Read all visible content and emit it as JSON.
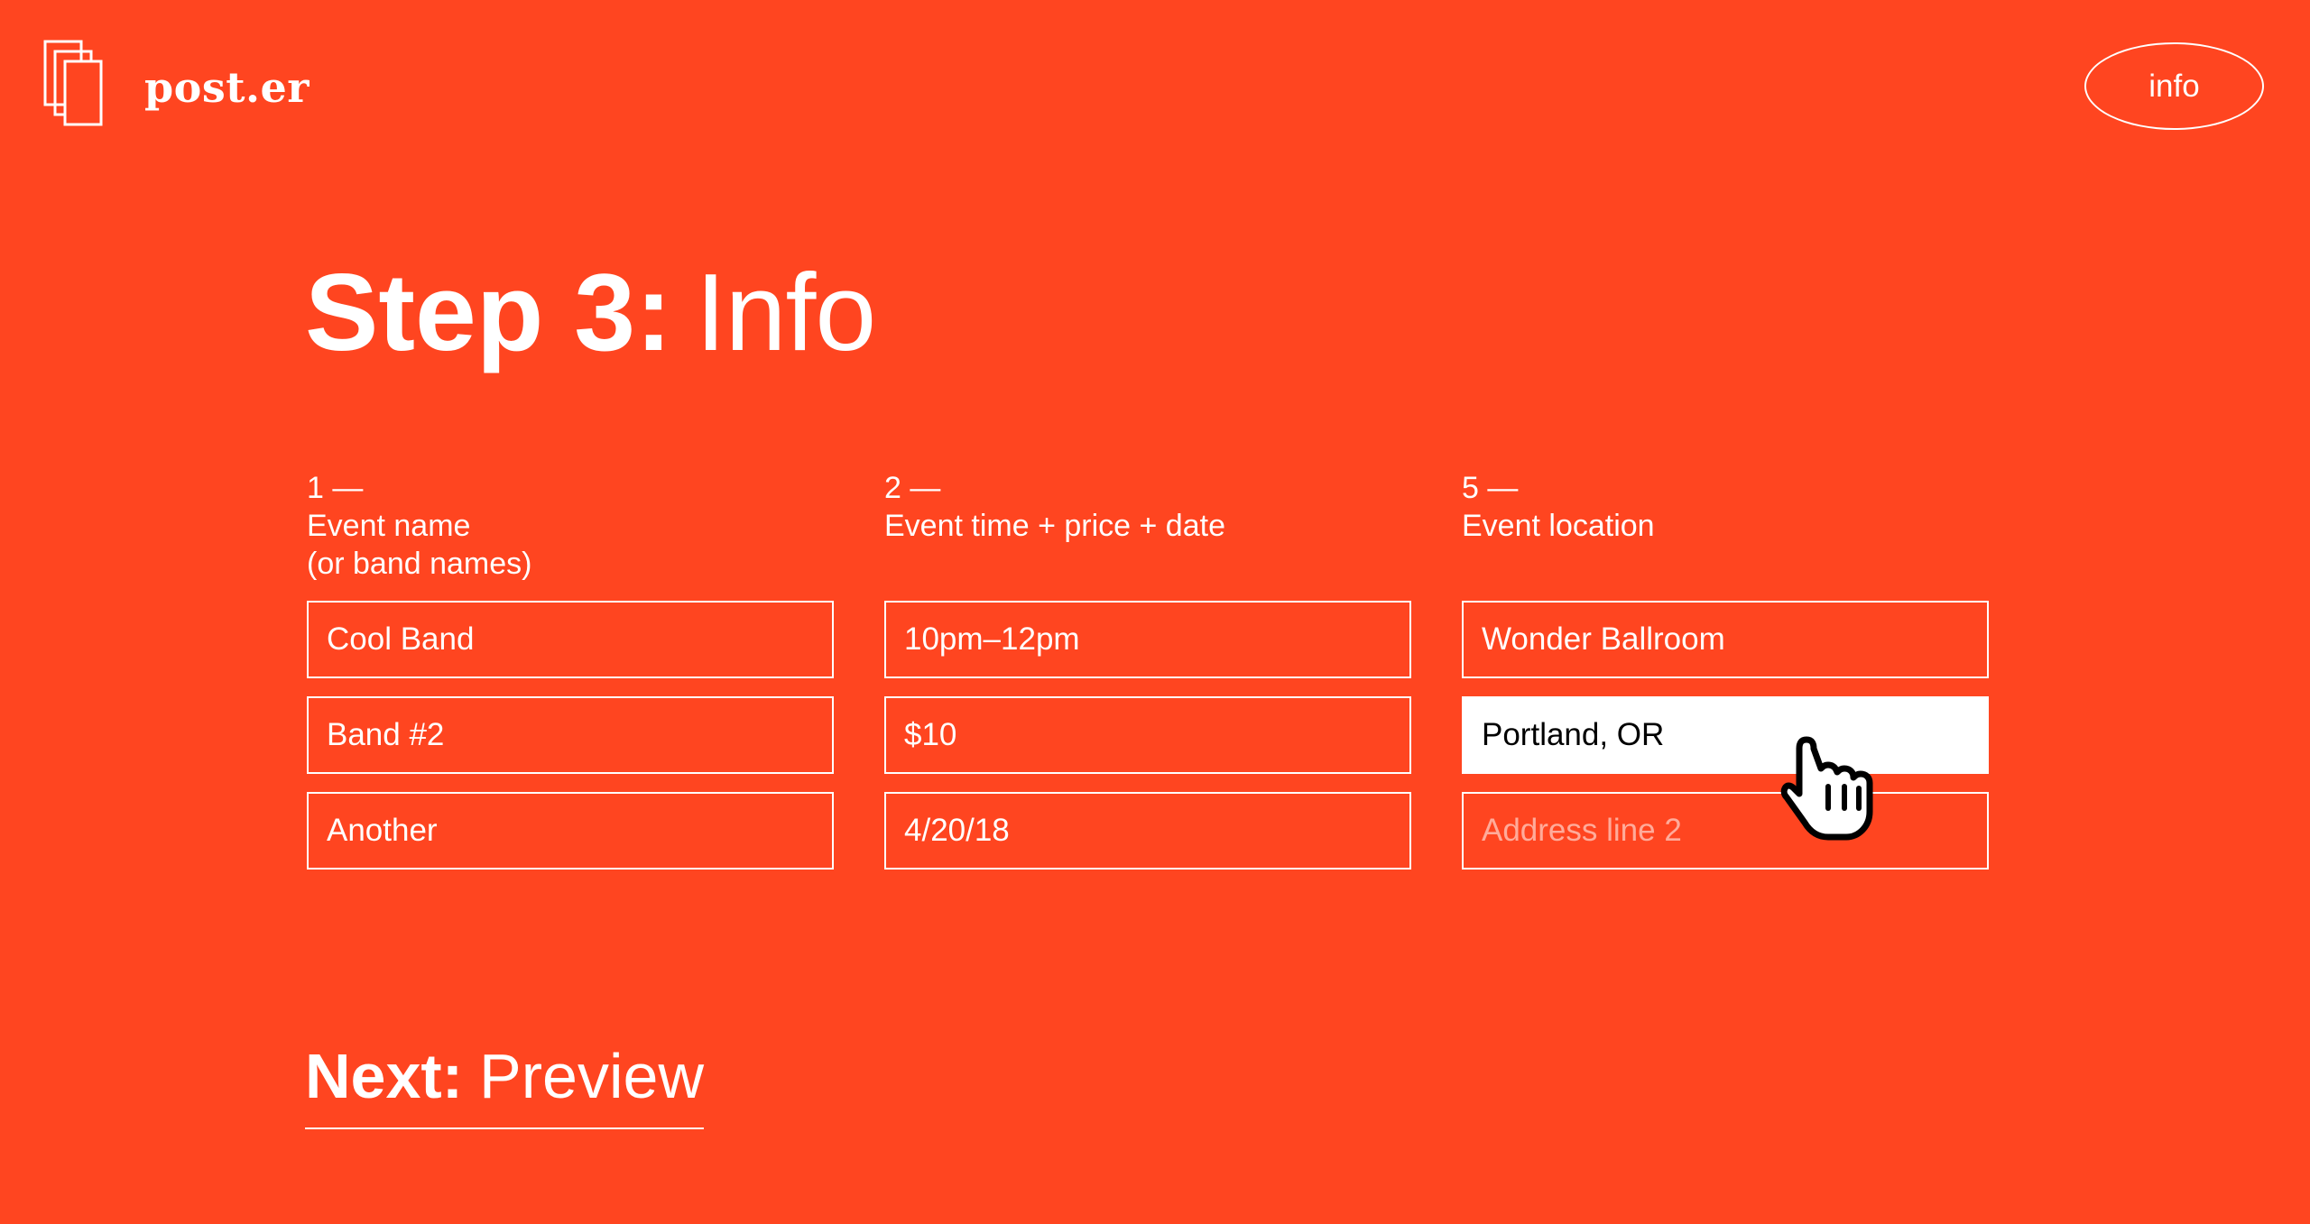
{
  "brand": {
    "name": "post.er",
    "icon": "stacked-pages-icon"
  },
  "header": {
    "info_label": "info"
  },
  "page": {
    "title_strong": "Step 3:",
    "title_light": "Info"
  },
  "columns": [
    {
      "number": "1 —",
      "label_line1": "Event name",
      "label_line2": "(or band names)",
      "fields": [
        {
          "value": "Cool Band"
        },
        {
          "value": "Band #2"
        },
        {
          "value": "Another"
        }
      ]
    },
    {
      "number": "2 —",
      "label_line1": "Event time + price + date",
      "fields": [
        {
          "value": "10pm–12pm"
        },
        {
          "value": "$10"
        },
        {
          "value": "4/20/18"
        }
      ]
    },
    {
      "number": "5 —",
      "label_line1": "Event location",
      "fields": [
        {
          "value": "Wonder Ballroom"
        },
        {
          "value": "Portland, OR"
        },
        {
          "placeholder": "Address line 2"
        }
      ]
    }
  ],
  "footer": {
    "next_strong": "Next:",
    "next_light": "Preview"
  },
  "cursor": {
    "icon": "hand-pointer-icon"
  },
  "colors": {
    "background": "#FF4520",
    "foreground": "#FFFFFF",
    "active_field_text": "#000000"
  }
}
